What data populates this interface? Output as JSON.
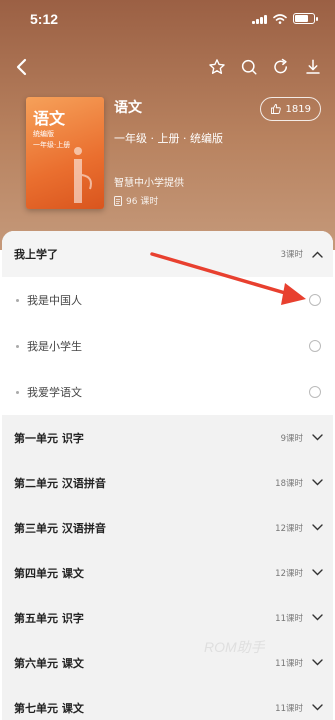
{
  "status": {
    "time": "5:12"
  },
  "book": {
    "title": "语文",
    "grade": "一年级 · 上册 · 统编版",
    "provider": "智慧中小学提供",
    "lessons": "96 课时",
    "likes": "1819",
    "cover_title": "语文",
    "cover_line1": "统编版",
    "cover_line2": "一年级·上册",
    "cover_color": "#ea6f2f"
  },
  "nav": {
    "icons": [
      "back-icon",
      "star-icon",
      "search-icon",
      "refresh-icon",
      "download-icon"
    ]
  },
  "expanded_unit": {
    "title": "我上学了",
    "count": "3课时",
    "lessons": [
      {
        "title": "我是中国人"
      },
      {
        "title": "我是小学生"
      },
      {
        "title": "我爱学语文"
      }
    ]
  },
  "units": [
    {
      "title": "第一单元 识字",
      "count": "9课时"
    },
    {
      "title": "第二单元 汉语拼音",
      "count": "18课时"
    },
    {
      "title": "第三单元 汉语拼音",
      "count": "12课时"
    },
    {
      "title": "第四单元 课文",
      "count": "12课时"
    },
    {
      "title": "第五单元 识字",
      "count": "11课时"
    },
    {
      "title": "第六单元 课文",
      "count": "11课时"
    },
    {
      "title": "第七单元 课文",
      "count": "11课时"
    }
  ],
  "watermark": "ROM助手",
  "colors": {
    "accent": "#e8402f",
    "hero": "#b8825f"
  }
}
